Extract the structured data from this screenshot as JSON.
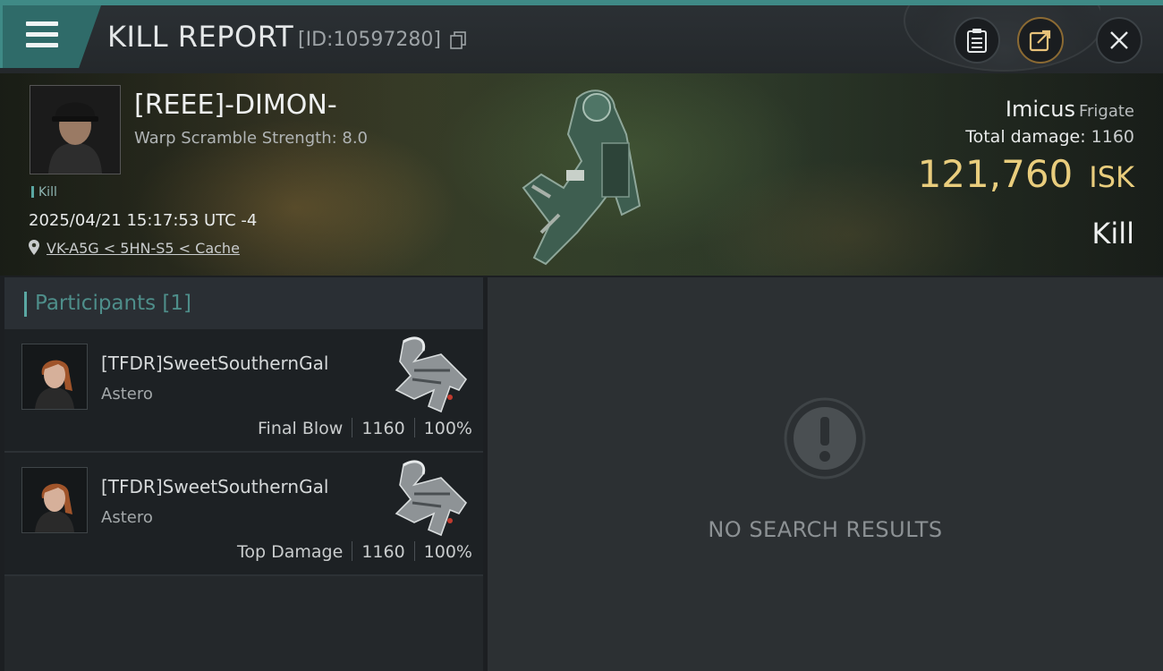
{
  "header": {
    "title": "KILL REPORT",
    "report_id": "[ID:10597280]"
  },
  "victim": {
    "name": "[REEE]-DIMON-",
    "warp_scramble": "Warp Scramble Strength: 8.0",
    "tag": "Kill",
    "datetime": "2025/04/21 15:17:53 UTC -4",
    "location": "VK-A5G < 5HN-S5 < Cache",
    "ship_name": "Imicus",
    "ship_class": "Frigate",
    "total_damage_label": "Total damage:",
    "total_damage_value": "1160",
    "isk_value": "121,760",
    "isk_unit": "ISK",
    "result": "Kill"
  },
  "participants": {
    "header": "Participants [1]",
    "rows": [
      {
        "name": "[TFDR]SweetSouthernGal",
        "ship": "Astero",
        "role": "Final Blow",
        "damage": "1160",
        "percent": "100%"
      },
      {
        "name": "[TFDR]SweetSouthernGal",
        "ship": "Astero",
        "role": "Top Damage",
        "damage": "1160",
        "percent": "100%"
      }
    ]
  },
  "right_panel": {
    "empty_text": "NO SEARCH RESULTS"
  },
  "colors": {
    "accent_teal": "#3f8a86",
    "isk_gold": "#e9cd7d",
    "orange_button": "#8b6a33"
  },
  "icons": [
    "menu-icon",
    "copy-icon",
    "clipboard-icon",
    "share-icon",
    "close-icon",
    "location-pin-icon",
    "exclamation-icon"
  ]
}
